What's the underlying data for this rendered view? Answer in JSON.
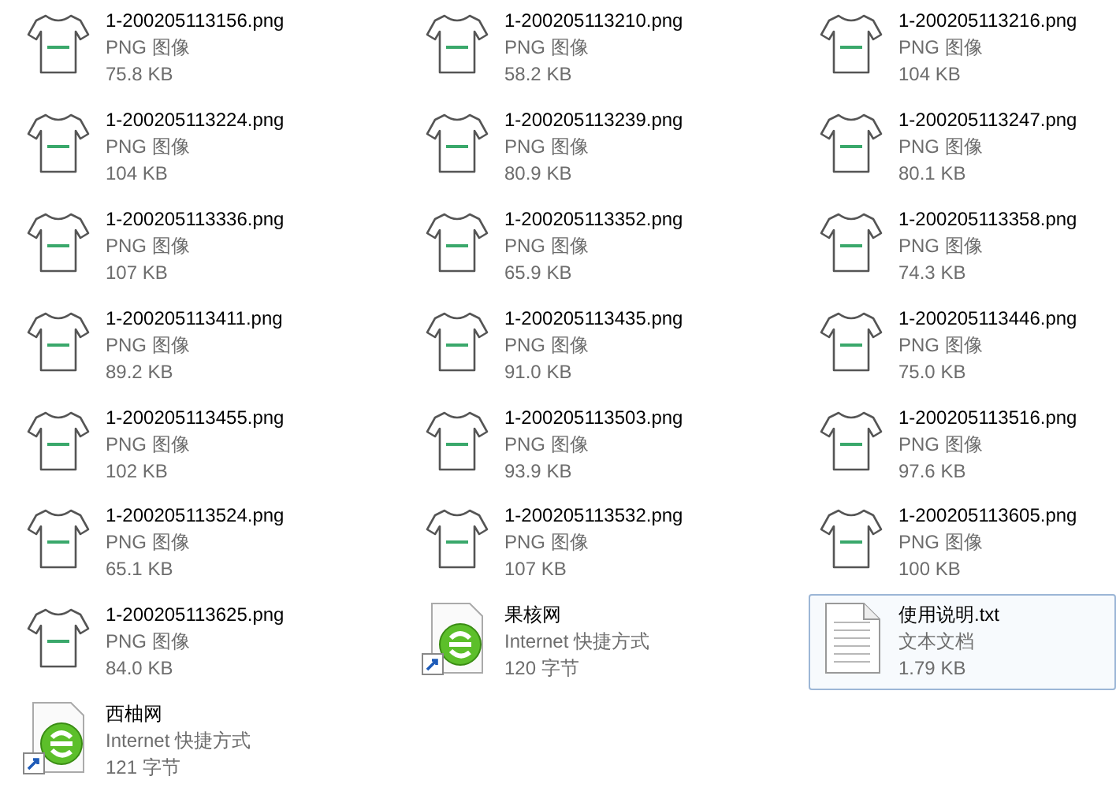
{
  "files": [
    {
      "kind": "image",
      "name": "1-200205113156.png",
      "type": "PNG 图像",
      "size": "75.8 KB",
      "selected": false
    },
    {
      "kind": "image",
      "name": "1-200205113210.png",
      "type": "PNG 图像",
      "size": "58.2 KB",
      "selected": false
    },
    {
      "kind": "image",
      "name": "1-200205113216.png",
      "type": "PNG 图像",
      "size": "104 KB",
      "selected": false
    },
    {
      "kind": "image",
      "name": "1-200205113224.png",
      "type": "PNG 图像",
      "size": "104 KB",
      "selected": false
    },
    {
      "kind": "image",
      "name": "1-200205113239.png",
      "type": "PNG 图像",
      "size": "80.9 KB",
      "selected": false
    },
    {
      "kind": "image",
      "name": "1-200205113247.png",
      "type": "PNG 图像",
      "size": "80.1 KB",
      "selected": false
    },
    {
      "kind": "image",
      "name": "1-200205113336.png",
      "type": "PNG 图像",
      "size": "107 KB",
      "selected": false
    },
    {
      "kind": "image",
      "name": "1-200205113352.png",
      "type": "PNG 图像",
      "size": "65.9 KB",
      "selected": false
    },
    {
      "kind": "image",
      "name": "1-200205113358.png",
      "type": "PNG 图像",
      "size": "74.3 KB",
      "selected": false
    },
    {
      "kind": "image",
      "name": "1-200205113411.png",
      "type": "PNG 图像",
      "size": "89.2 KB",
      "selected": false
    },
    {
      "kind": "image",
      "name": "1-200205113435.png",
      "type": "PNG 图像",
      "size": "91.0 KB",
      "selected": false
    },
    {
      "kind": "image",
      "name": "1-200205113446.png",
      "type": "PNG 图像",
      "size": "75.0 KB",
      "selected": false
    },
    {
      "kind": "image",
      "name": "1-200205113455.png",
      "type": "PNG 图像",
      "size": "102 KB",
      "selected": false
    },
    {
      "kind": "image",
      "name": "1-200205113503.png",
      "type": "PNG 图像",
      "size": "93.9 KB",
      "selected": false
    },
    {
      "kind": "image",
      "name": "1-200205113516.png",
      "type": "PNG 图像",
      "size": "97.6 KB",
      "selected": false
    },
    {
      "kind": "image",
      "name": "1-200205113524.png",
      "type": "PNG 图像",
      "size": "65.1 KB",
      "selected": false
    },
    {
      "kind": "image",
      "name": "1-200205113532.png",
      "type": "PNG 图像",
      "size": "107 KB",
      "selected": false
    },
    {
      "kind": "image",
      "name": "1-200205113605.png",
      "type": "PNG 图像",
      "size": "100 KB",
      "selected": false
    },
    {
      "kind": "image",
      "name": "1-200205113625.png",
      "type": "PNG 图像",
      "size": "84.0 KB",
      "selected": false
    },
    {
      "kind": "shortcut",
      "name": "果核网",
      "type": "Internet 快捷方式",
      "size": "120 字节",
      "selected": false
    },
    {
      "kind": "text",
      "name": "使用说明.txt",
      "type": "文本文档",
      "size": "1.79 KB",
      "selected": true
    },
    {
      "kind": "shortcut",
      "name": "西柚网",
      "type": "Internet 快捷方式",
      "size": "121 字节",
      "selected": false
    }
  ]
}
